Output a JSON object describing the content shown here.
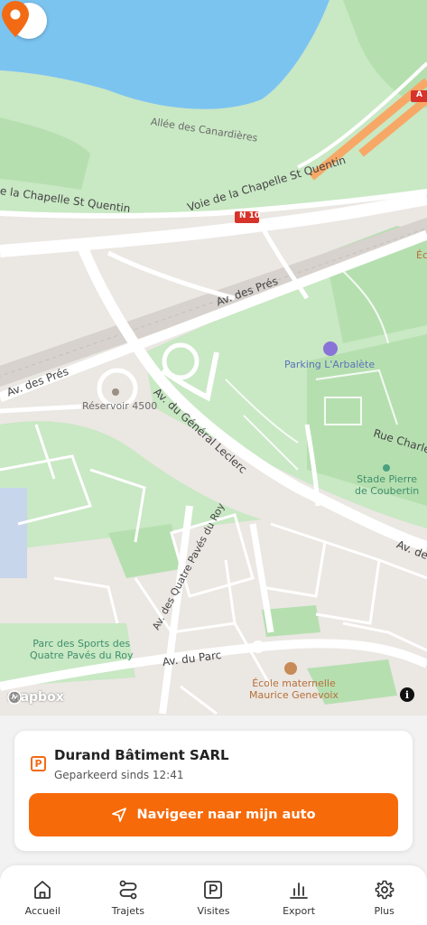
{
  "map": {
    "labels": {
      "allee": "Allée des Canardières",
      "voie_left": "e la Chapelle St Quentin",
      "voie_right": "Voie de la Chapelle St Quentin",
      "n10": "N 10",
      "a_shield": "A",
      "av_pres_1": "Av. des Prés",
      "av_pres_2": "Av. des Prés",
      "reservoir": "Réservoir 4500",
      "gen_leclerc": "Av. du Général Leclerc",
      "parking": "Parking L'Arbalète",
      "rue_charles": "Rue Charles",
      "stade": "Stade Pierre\nde Coubertin",
      "av_de": "Av. de",
      "quatre_paves": "Av. des Quatre Pavés du Roy",
      "parc_sports": "Parc des Sports des\nQuatre Pavés du Roy",
      "av_parc": "Av. du Parc",
      "ecole": "École maternelle\nMaurice Genevoix",
      "eco_partial": "Éco"
    },
    "attribution": "mapbox",
    "info_glyph": "i",
    "colors": {
      "land": "#ebe7e3",
      "water": "#7cc4f0",
      "park": "#c9e8c4",
      "park_dark": "#a9d9a4",
      "road": "#ffffff",
      "highway": "#f7a866",
      "pin": "#f26a14"
    }
  },
  "card": {
    "badge": "P",
    "company": "Durand Bâtiment SARL",
    "status": "Geparkeerd sinds 12:41",
    "nav_button": "Navigeer naar mijn auto",
    "accent": "#f76a09"
  },
  "bottom_nav": {
    "items": [
      {
        "label": "Accueil",
        "icon": "home-icon"
      },
      {
        "label": "Trajets",
        "icon": "route-icon"
      },
      {
        "label": "Visites",
        "icon": "parking-icon"
      },
      {
        "label": "Export",
        "icon": "bar-chart-icon"
      },
      {
        "label": "Plus",
        "icon": "gear-icon"
      }
    ]
  }
}
